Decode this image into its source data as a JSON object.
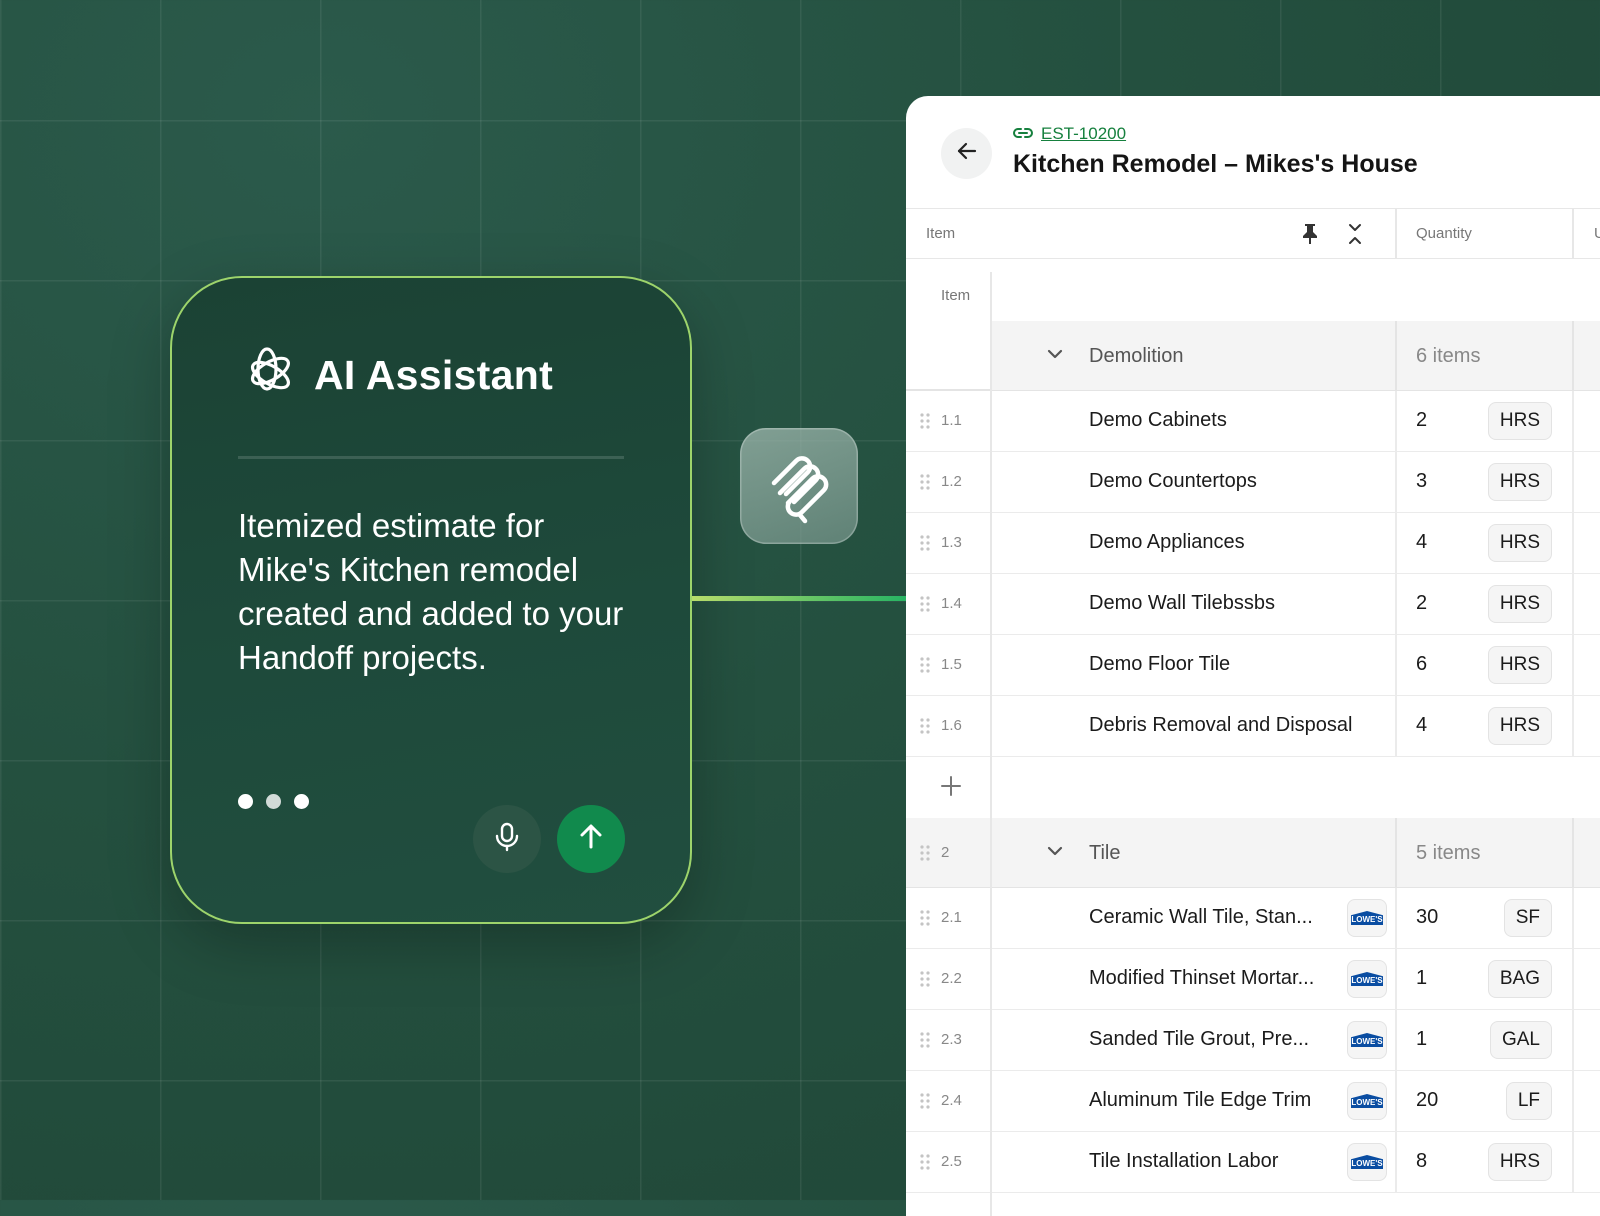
{
  "assistant": {
    "title": "AI Assistant",
    "message": "Itemized estimate for Mike's Kitchen remodel created and added to your Handoff projects."
  },
  "estimate": {
    "id": "EST-10200",
    "title": "Kitchen Remodel – Mikes's House"
  },
  "table": {
    "columns": {
      "item": "Item",
      "quantity": "Quantity",
      "unit_partial": "U"
    },
    "sub_header": "Item",
    "groups": [
      {
        "number": "",
        "name": "Demolition",
        "count": "6 items",
        "rows": [
          {
            "num": "1.1",
            "name": "Demo Cabinets",
            "qty": "2",
            "unit": "HRS",
            "vendor": ""
          },
          {
            "num": "1.2",
            "name": "Demo Countertops",
            "qty": "3",
            "unit": "HRS",
            "vendor": ""
          },
          {
            "num": "1.3",
            "name": "Demo Appliances",
            "qty": "4",
            "unit": "HRS",
            "vendor": ""
          },
          {
            "num": "1.4",
            "name": "Demo Wall Tilebssbs",
            "qty": "2",
            "unit": "HRS",
            "vendor": ""
          },
          {
            "num": "1.5",
            "name": "Demo Floor Tile",
            "qty": "6",
            "unit": "HRS",
            "vendor": ""
          },
          {
            "num": "1.6",
            "name": "Debris Removal and Disposal",
            "qty": "4",
            "unit": "HRS",
            "vendor": ""
          }
        ]
      },
      {
        "number": "2",
        "name": "Tile",
        "count": "5 items",
        "rows": [
          {
            "num": "2.1",
            "name": "Ceramic Wall Tile, Stan...",
            "qty": "30",
            "unit": "SF",
            "vendor": "LOWE'S"
          },
          {
            "num": "2.2",
            "name": "Modified Thinset Mortar...",
            "qty": "1",
            "unit": "BAG",
            "vendor": "LOWE'S"
          },
          {
            "num": "2.3",
            "name": "Sanded Tile Grout, Pre...",
            "qty": "1",
            "unit": "GAL",
            "vendor": "LOWE'S"
          },
          {
            "num": "2.4",
            "name": "Aluminum Tile Edge Trim",
            "qty": "20",
            "unit": "LF",
            "vendor": "LOWE'S"
          },
          {
            "num": "2.5",
            "name": "Tile Installation Labor",
            "qty": "8",
            "unit": "HRS",
            "vendor": "LOWE'S"
          }
        ]
      }
    ]
  },
  "colors": {
    "accent": "#118a4d",
    "link": "#16803e",
    "background": "#24503f"
  },
  "icons": [
    "openai-icon",
    "mic-icon",
    "send-arrow-icon",
    "handoff-app-icon",
    "back-arrow-icon",
    "link-icon",
    "pin-icon",
    "collapse-icon",
    "chevron-down-icon",
    "drag-handle-icon",
    "plus-icon",
    "lowes-logo"
  ]
}
